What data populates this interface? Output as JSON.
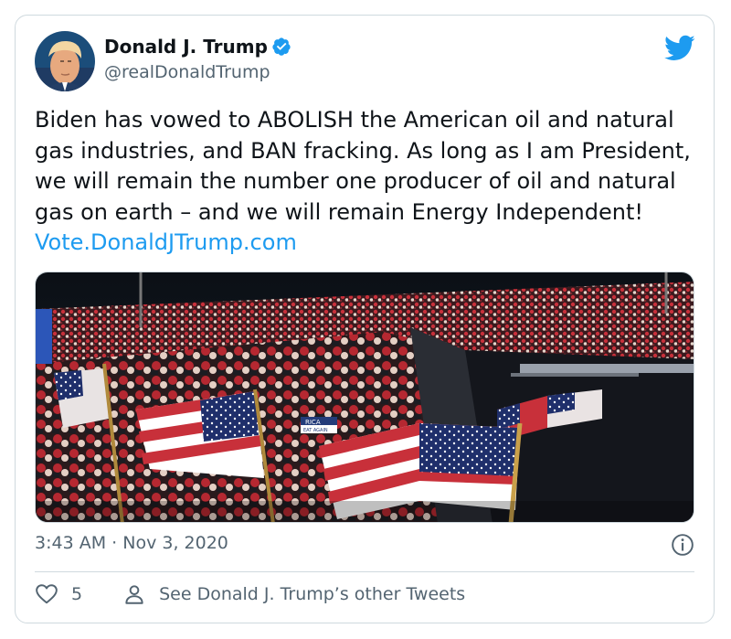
{
  "author": {
    "display_name": "Donald J. Trump",
    "handle": "@realDonaldTrump",
    "verified": true
  },
  "tweet": {
    "text": "Biden has vowed to ABOLISH the American oil and natural gas industries, and BAN fracking. As long as I am President, we will remain the number one producer of oil and natural gas on earth – and we will remain Energy Independent!",
    "link_text": "Vote.DonaldJTrump.com",
    "media_signs": [
      "RICA",
      "EAT AGAIN"
    ]
  },
  "meta": {
    "time": "3:43 AM",
    "separator": "·",
    "date": "Nov 3, 2020"
  },
  "actions": {
    "like_count": "5",
    "other_tweets_label": "See Donald J. Trump’s other Tweets"
  },
  "icons": {
    "brand": "twitter-bird-icon",
    "verified": "verified-badge-icon",
    "info": "info-icon",
    "like": "heart-icon",
    "profile": "person-icon"
  },
  "colors": {
    "accent": "#1d9bf0",
    "text": "#0f1419",
    "muted": "#536471",
    "border": "#cfd9de"
  }
}
